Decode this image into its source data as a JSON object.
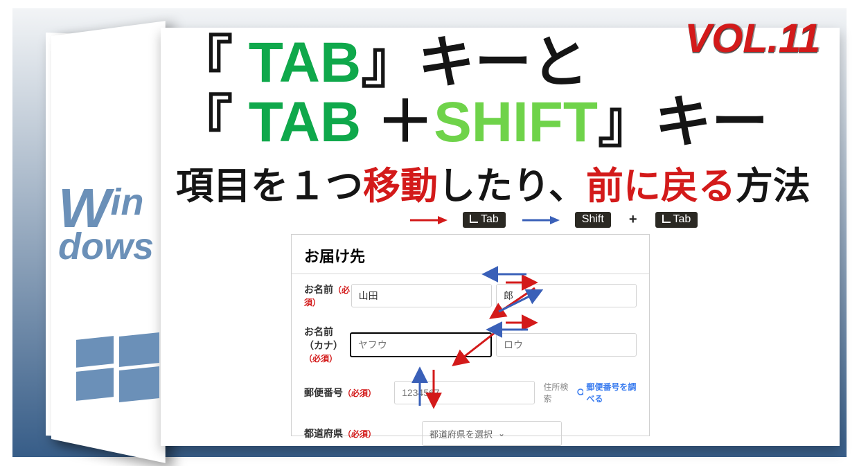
{
  "volume": "VOL.11",
  "title": {
    "line1_pre": "『 ",
    "line1_tab": "TAB",
    "line1_post": "』キーと",
    "line2_pre": "『 ",
    "line2_tab": "TAB",
    "line2_plus": "＋",
    "line2_shift": "SHIFT",
    "line2_post": "』キー"
  },
  "subtitle": {
    "a": "項目を１つ",
    "b": "移動",
    "c": "したり、",
    "d": "前に戻る",
    "e": "方法"
  },
  "legend": {
    "tab": "Tab",
    "shift": "Shift",
    "plus": "+"
  },
  "brand": {
    "w": "W",
    "in": "in",
    "dows": "dows"
  },
  "form": {
    "panel_title": "お届け先",
    "required": "（必須）",
    "rows": {
      "name": {
        "label": "お名前",
        "v1": "山田",
        "v2": "郎"
      },
      "kana": {
        "label": "お名前（カナ）",
        "ph1": "ヤフウ",
        "ph2": "ロウ"
      },
      "postal": {
        "label": "郵便番号",
        "ph": "1234567",
        "search": "住所検索",
        "lookup": "郵便番号を調べる"
      },
      "pref": {
        "label": "都道府県",
        "select": "都道府県を選択"
      }
    }
  }
}
